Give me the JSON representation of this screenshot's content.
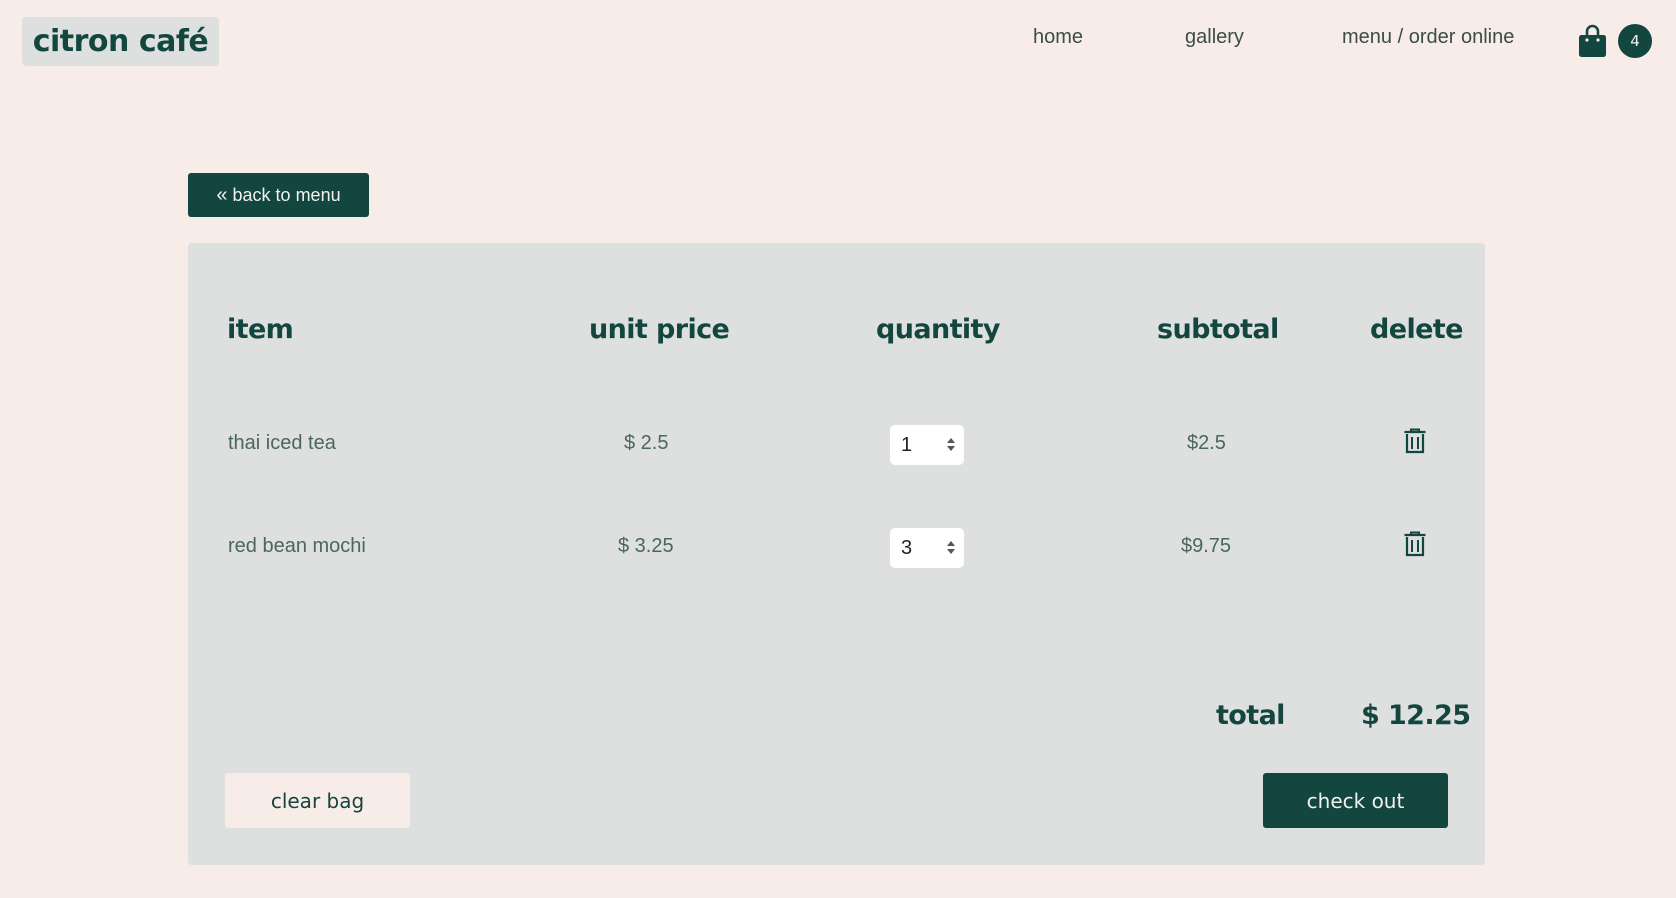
{
  "header": {
    "brand": "citron café",
    "nav": [
      {
        "label": "home"
      },
      {
        "label": "gallery"
      },
      {
        "label": "menu / order online"
      }
    ],
    "bag_count": "4"
  },
  "back_button": {
    "label": "back to menu"
  },
  "cart": {
    "columns": [
      "item",
      "unit price",
      "quantity",
      "subtotal",
      "delete"
    ],
    "rows": [
      {
        "item": "thai iced tea",
        "unit_price": "$ 2.5",
        "quantity": "1",
        "subtotal": "$2.5"
      },
      {
        "item": "red bean mochi",
        "unit_price": "$ 3.25",
        "quantity": "3",
        "subtotal": "$9.75"
      }
    ],
    "total_label": "total",
    "total_value": "$ 12.25",
    "clear_label": "clear bag",
    "checkout_label": "check out"
  },
  "icons": {
    "back": "double-chevron-left-icon",
    "bag": "shopping-bag-icon",
    "delete": "trash-icon",
    "spinner": "spinner-arrows-icon"
  },
  "colors": {
    "page_bg": "#f7ece7",
    "panel_bg": "#dde0df",
    "accent": "#12463e"
  }
}
